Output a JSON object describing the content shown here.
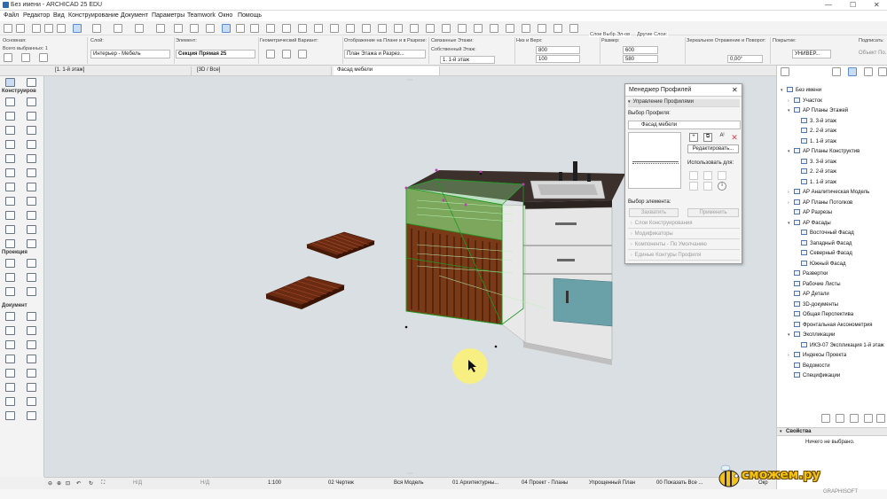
{
  "window": {
    "title": "Без имени - ARCHICAD 25 EDU"
  },
  "menu": [
    "Файл",
    "Редактор",
    "Вид",
    "Конструирование",
    "Документ",
    "Параметры",
    "Teamwork",
    "Окно",
    "Помощь"
  ],
  "infobox": {
    "basic_label": "Основная:",
    "selected_label": "Всего выбранных: 1",
    "layer_label": "Слой:",
    "layer_value": "Интерьер - Мебель",
    "element_label": "Элемент:",
    "element_value": "Секция Прямая 25",
    "geom_label": "Геометрический Вариант:",
    "display_label": "Отображение на Плане и в Разрезе:",
    "display_value": "План Этажа и Разрез...",
    "stories_label": "Связанные Этажи:",
    "own_story": "Собственный Этаж:",
    "story_value": "1. 1-й этаж",
    "bottom_top_label": "Низ и Верх:",
    "val_800": "800",
    "val_100": "100",
    "size_label": "Размер:",
    "val_600": "600",
    "val_580": "580",
    "layers_top": "Слои Выбр.Эл-ов",
    "other_layers": "Другие Слои:",
    "mirror_label": "Зеркальное Отражение и Поворот:",
    "angle": "0,00°",
    "cover_label": "Покрытие:",
    "cover_value": "УНИВЕР...",
    "sign_label": "Подписать:",
    "sign_value": "Объект По..."
  },
  "tabs": [
    "[1. 1-й этаж]",
    "[3D / Все]",
    "Фасад мебели"
  ],
  "toolbox": {
    "construct": "Конструиров",
    "projection": "Проекция",
    "document": "Документ"
  },
  "profile_manager": {
    "title": "Менеджер Профилей",
    "manage": "Управление Профилями",
    "select_profile": "Выбор Профиля:",
    "profile_name": "Фасад мебели",
    "edit_btn": "Редактировать...",
    "use_for": "Использовать для:",
    "element_select": "Выбор элемента:",
    "capture_btn": "Захватить",
    "apply_btn": "Применить",
    "sections": [
      "Слои Конструирования",
      "Модификаторы",
      "Компоненты - По Умолчанию",
      "Единые Контуры Профиля"
    ]
  },
  "navigator": {
    "items": [
      {
        "label": "Без имени",
        "level": 0,
        "exp": "▾"
      },
      {
        "label": "Участок",
        "level": 1,
        "exp": "›"
      },
      {
        "label": "АР Планы Этажей",
        "level": 1,
        "exp": "▾"
      },
      {
        "label": "3. 3-й этаж",
        "level": 2,
        "exp": ""
      },
      {
        "label": "2. 2-й этаж",
        "level": 2,
        "exp": ""
      },
      {
        "label": "1. 1-й этаж",
        "level": 2,
        "exp": ""
      },
      {
        "label": "АР Планы Конструктив",
        "level": 1,
        "exp": "▾"
      },
      {
        "label": "3. 3-й этаж",
        "level": 2,
        "exp": ""
      },
      {
        "label": "2. 2-й этаж",
        "level": 2,
        "exp": ""
      },
      {
        "label": "1. 1-й этаж",
        "level": 2,
        "exp": ""
      },
      {
        "label": "АР Аналитическая Модель",
        "level": 1,
        "exp": "›"
      },
      {
        "label": "АР Планы Потолков",
        "level": 1,
        "exp": "›"
      },
      {
        "label": "АР Разрезы",
        "level": 1,
        "exp": ""
      },
      {
        "label": "АР Фасады",
        "level": 1,
        "exp": "▾"
      },
      {
        "label": "Восточный Фасад",
        "level": 2,
        "exp": ""
      },
      {
        "label": "Западный Фасад",
        "level": 2,
        "exp": ""
      },
      {
        "label": "Северный Фасад",
        "level": 2,
        "exp": ""
      },
      {
        "label": "Южный Фасад",
        "level": 2,
        "exp": ""
      },
      {
        "label": "Развертки",
        "level": 1,
        "exp": ""
      },
      {
        "label": "Рабочие Листы",
        "level": 1,
        "exp": ""
      },
      {
        "label": "АР Детали",
        "level": 1,
        "exp": ""
      },
      {
        "label": "3D-документы",
        "level": 1,
        "exp": ""
      },
      {
        "label": "Общая Перспектива",
        "level": 1,
        "exp": ""
      },
      {
        "label": "Фронтальная Аксонометрия",
        "level": 1,
        "exp": ""
      },
      {
        "label": "Экспликации",
        "level": 1,
        "exp": "▾"
      },
      {
        "label": "ИКЭ-07 Экспликация 1-й этаж",
        "level": 2,
        "exp": ""
      },
      {
        "label": "Индексы Проекта",
        "level": 1,
        "exp": "›"
      },
      {
        "label": "Ведомости",
        "level": 1,
        "exp": ""
      },
      {
        "label": "Спецификации",
        "level": 1,
        "exp": ""
      }
    ]
  },
  "properties": {
    "header": "Свойства",
    "empty": "Ничего не выбрано."
  },
  "statusbar": {
    "nd1": "Н/Д",
    "nd2": "Н/Д",
    "scale": "1:100",
    "drawing": "02 Чертеж",
    "model": "Вся Модель",
    "arch": "01 Архитектурны...",
    "project": "04 Проект - Планы",
    "simple": "Упрощенный План",
    "show": "00 Показать Все ...",
    "extra": "Окр"
  },
  "logo": {
    "text": "сможем.ру",
    "vendor": "GRAPHISOFT"
  }
}
